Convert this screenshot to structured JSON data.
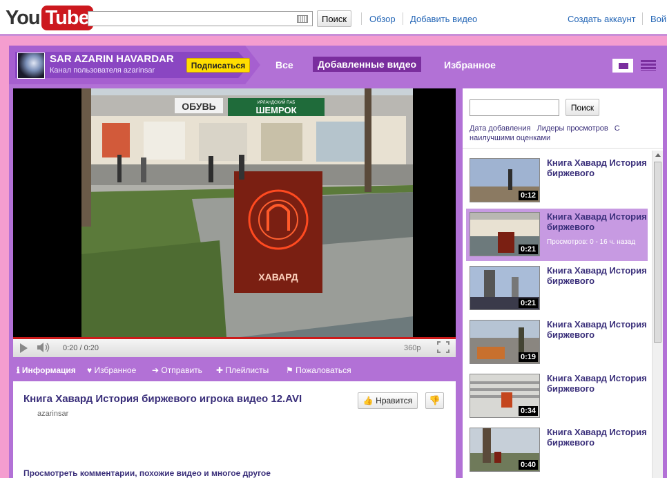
{
  "header": {
    "logo_you": "You",
    "logo_tube": "Tube",
    "search_button": "Поиск",
    "links": [
      "Обзор",
      "Добавить видео"
    ],
    "right_links": [
      "Создать аккаунт",
      "Вой"
    ]
  },
  "channel": {
    "name": "SAR AZARIN HAVARDAR",
    "subtitle": "Канал пользователя azarinsar",
    "subscribe": "Подписаться",
    "tabs": [
      "Все",
      "Добавленные видео",
      "Избранное"
    ],
    "active_tab": "Добавленные видео"
  },
  "player": {
    "time": "0:20 / 0:20",
    "quality": "360p",
    "progress_fraction": 1.0
  },
  "infobar": {
    "items": [
      "Информация",
      "Избранное",
      "Отправить",
      "Плейлисты",
      "Пожаловаться"
    ]
  },
  "video": {
    "title": "Книга Хавард История биржевого игрока видео 12.AVI",
    "user": "azarinsar",
    "like": "Нравится",
    "more": "Просмотреть комментарии, похожие видео и многое другое"
  },
  "sidebar": {
    "search_button": "Поиск",
    "sort_links": [
      "Дата добавления",
      "Лидеры просмотров",
      "С наилучшими оценками"
    ],
    "items": [
      {
        "title": "Книга Хавард История биржевого",
        "duration": "0:12",
        "views": ""
      },
      {
        "title": "Книга Хавард История биржевого",
        "duration": "0:21",
        "views": "Просмотров: 0 - 16 ч. назад"
      },
      {
        "title": "Книга Хавард История биржевого",
        "duration": "0:21",
        "views": ""
      },
      {
        "title": "Книга Хавард История биржевого",
        "duration": "0:19",
        "views": ""
      },
      {
        "title": "Книга Хавард История биржевого",
        "duration": "0:34",
        "views": ""
      },
      {
        "title": "Книга Хавард История биржевого",
        "duration": "0:40",
        "views": ""
      }
    ],
    "selected_index": 1
  },
  "video_frame": {
    "sign_shoes": "ОБУВЬ",
    "sign_shop": "ШЕМРОК",
    "sign_pub": "ИРЛАНДСКИЙ ПАБ",
    "book_label": "ХАВАРД"
  },
  "colors": {
    "page_bg": "#f49dcf",
    "frame_purple": "#b271d6",
    "active_tab": "#7a2e9e",
    "title_text": "#3a2f7a",
    "progress": "#cc1b1b"
  }
}
